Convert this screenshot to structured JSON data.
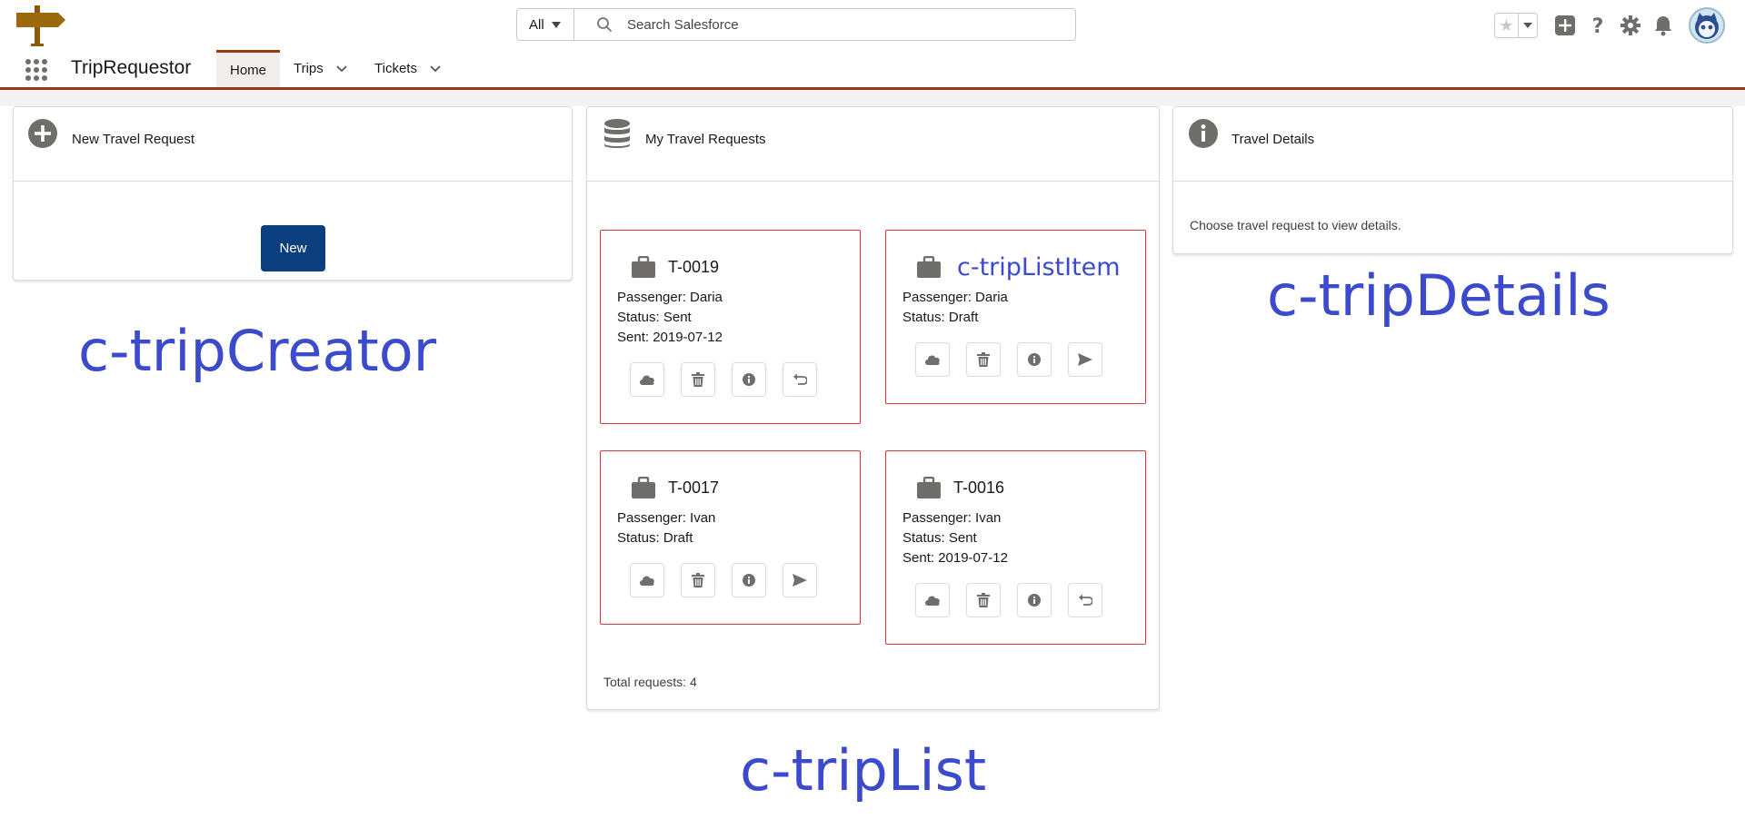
{
  "header": {
    "search": {
      "scope": "All",
      "placeholder": "Search Salesforce"
    },
    "icons": [
      "signpost-logo",
      "star-icon",
      "plus-icon",
      "help-icon",
      "gear-icon",
      "bell-icon",
      "avatar"
    ]
  },
  "nav": {
    "app_name": "TripRequestor",
    "tabs": [
      {
        "label": "Home",
        "active": true
      },
      {
        "label": "Trips",
        "has_menu": true
      },
      {
        "label": "Tickets",
        "has_menu": true
      }
    ]
  },
  "creator": {
    "title": "New Travel Request",
    "button": "New",
    "annotation": "c-tripCreator"
  },
  "list": {
    "title": "My Travel Requests",
    "annotation": "c-tripList",
    "item_annotation": "c-tripListItem",
    "total": "Total requests: 4",
    "trips": [
      {
        "name": "T-0019",
        "passenger": "Passenger: Daria",
        "status": "Status: Sent",
        "sent": "Sent: 2019-07-12"
      },
      {
        "name": "T-0017",
        "passenger": "Passenger: Ivan",
        "status": "Status: Draft"
      },
      {
        "name": "T-0016",
        "passenger": "Passenger: Ivan",
        "status": "Status: Sent",
        "sent": "Sent: 2019-07-12"
      },
      {
        "passenger": "Passenger: Daria",
        "status": "Status: Draft"
      }
    ]
  },
  "details": {
    "title": "Travel Details",
    "empty_text": "Choose travel request to view details.",
    "annotation": "c-tripDetails"
  },
  "colors": {
    "brand_border": "#9a3a14",
    "button_blue": "#0b3e7e",
    "trip_border": "#e0333d",
    "annotation": "#3b4bcc"
  }
}
